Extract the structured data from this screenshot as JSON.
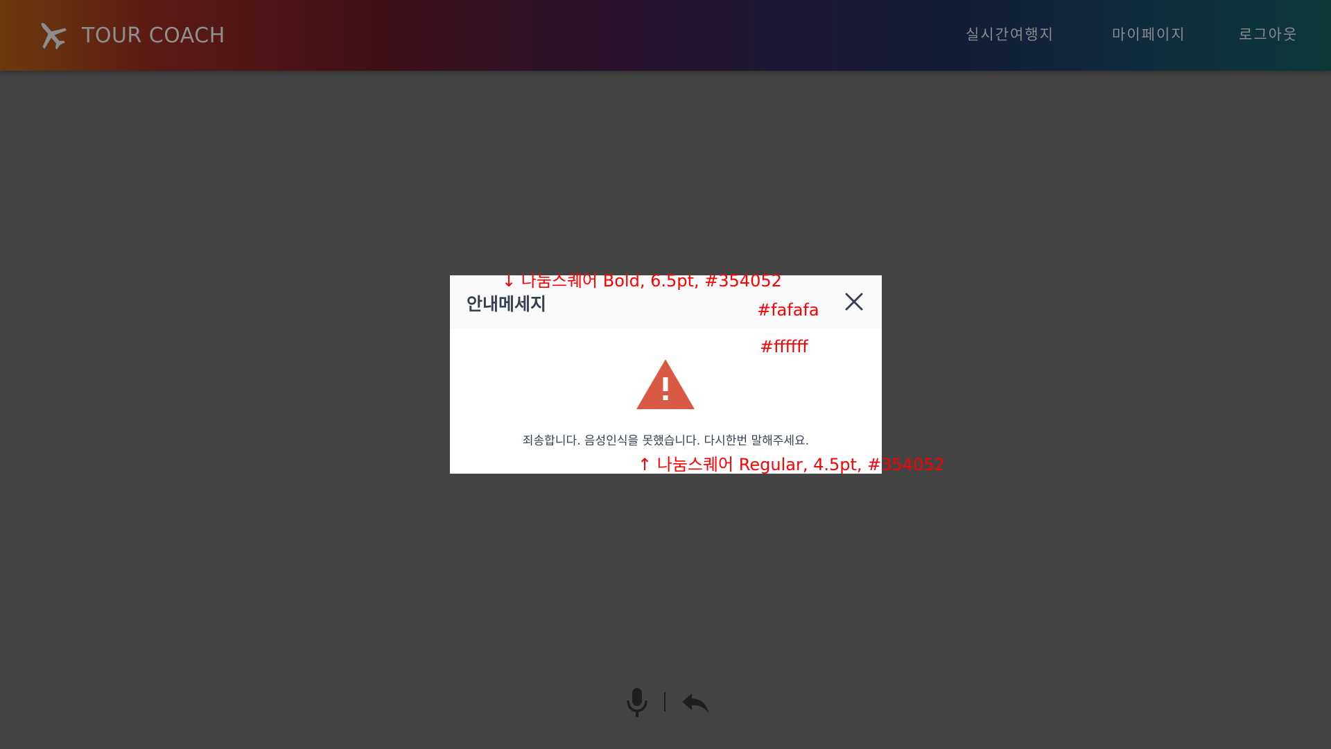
{
  "header": {
    "logo_text": "TOUR COACH",
    "nav": [
      "실시간여행지",
      "마이페이지",
      "로그아웃"
    ]
  },
  "dialog": {
    "title": "안내메세지",
    "message": "죄송합니다. 음성인식을 못했습니다. 다시한번 말해주세요.",
    "icons": {
      "warning": "warning-icon",
      "close": "close-icon"
    }
  },
  "annotations": {
    "title_spec": "↓ 나눔스퀘어 Bold, 6.5pt, #354052",
    "header_bg": "#fafafa",
    "body_bg": "#ffffff",
    "message_spec": "↑ 나눔스퀘어 Regular, 4.5pt, #354052"
  },
  "colors": {
    "overlay": "#444444",
    "text": "#354052",
    "warning": "#d95a44",
    "annotation": "#ff0000"
  },
  "controls": {
    "icons": [
      "microphone-icon",
      "reply-icon"
    ]
  }
}
